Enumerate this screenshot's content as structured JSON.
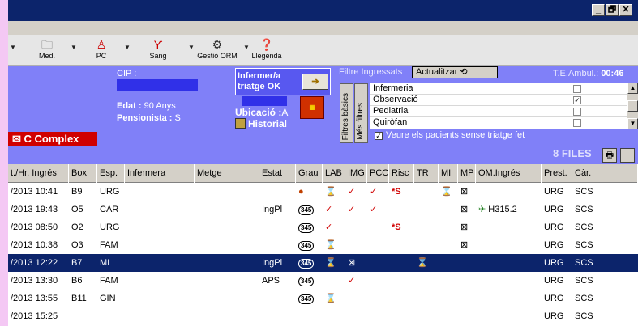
{
  "window": {
    "buttons": [
      "_",
      "🗗",
      "✕"
    ]
  },
  "toolbar": {
    "items": [
      {
        "label": "Med.",
        "icon": "folder-search-icon"
      },
      {
        "label": "PC",
        "icon": "pc-person-icon"
      },
      {
        "label": "Sang",
        "icon": "blood-icon"
      },
      {
        "label": "Gestió ORM",
        "icon": "orm-icon"
      },
      {
        "label": "Llegenda",
        "icon": "help-icon"
      }
    ]
  },
  "panel": {
    "cip_label": "CIP :",
    "edat_label": "Edat :",
    "edat_value": "90 Anys",
    "pensionista_label": "Pensionista :",
    "pensionista_value": "S",
    "triatge_line1": "Infermer/a",
    "triatge_line2": "triatge OK",
    "ubicacio_label": "Ubicació :",
    "ubicacio_value": "A",
    "historial": "Historial",
    "complex": "C Complex",
    "tab_basic": "Filtres bàsics",
    "tab_more": "Més filtres",
    "filtre_label": "Filtre Ingressats",
    "actualitzar": "Actualitzar",
    "temps_label": "T.E.Ambul.:",
    "temps_value": "00:46",
    "veure": "Veure els pacients sense triatge fet",
    "veure_checked": true,
    "filters": [
      {
        "name": "Infermeria",
        "checked": false
      },
      {
        "name": "Observació",
        "checked": true
      },
      {
        "name": "Pediatria",
        "checked": false
      },
      {
        "name": "Quiròfan",
        "checked": false
      }
    ]
  },
  "files_label": "8 FILES",
  "table": {
    "columns": [
      "t./Hr. Ingrés",
      "Box",
      "Esp.",
      "Infermera",
      "Metge",
      "Estat",
      "Grau",
      "LAB",
      "IMG",
      "PCO",
      "Risc",
      "TR",
      "MI",
      "MP",
      "OM.Ingrés",
      "Prest.",
      "Càr."
    ],
    "rows": [
      {
        "date": "/2013 10:41",
        "box": "B9",
        "esp": "URG",
        "infermera": "",
        "metge": "",
        "estat": "",
        "grau": "●",
        "lab": "⌛",
        "img": "✓",
        "pco": "✓",
        "risc": "*S",
        "tr": "",
        "mi": "⌛",
        "mp": "⊠",
        "om": "",
        "prest": "URG",
        "car": "SCS"
      },
      {
        "date": "/2013 19:43",
        "box": "O5",
        "esp": "CAR",
        "infermera": "",
        "metge": "",
        "estat": "IngPl",
        "grau": "345",
        "lab": "✓",
        "img": "✓",
        "pco": "✓",
        "risc": "",
        "tr": "",
        "mi": "",
        "mp": "⊠",
        "om": "H315.2",
        "prest": "URG",
        "car": "SCS"
      },
      {
        "date": "/2013 08:50",
        "box": "O2",
        "esp": "URG",
        "infermera": "",
        "metge": "",
        "estat": "",
        "grau": "345",
        "lab": "✓",
        "img": "",
        "pco": "",
        "risc": "*S",
        "tr": "",
        "mi": "",
        "mp": "⊠",
        "om": "",
        "prest": "URG",
        "car": "SCS"
      },
      {
        "date": "/2013 10:38",
        "box": "O3",
        "esp": "FAM",
        "infermera": "",
        "metge": "",
        "estat": "",
        "grau": "345",
        "lab": "⌛",
        "img": "",
        "pco": "",
        "risc": "",
        "tr": "",
        "mi": "",
        "mp": "⊠",
        "om": "",
        "prest": "URG",
        "car": "SCS"
      },
      {
        "date": "/2013 12:22",
        "box": "B7",
        "esp": "MI",
        "infermera": "",
        "metge": "",
        "estat": "IngPl",
        "grau": "345",
        "lab": "⌛",
        "img": "⊠",
        "pco": "",
        "risc": "",
        "tr": "⌛",
        "mi": "",
        "mp": "",
        "om": "",
        "prest": "URG",
        "car": "SCS"
      },
      {
        "date": "/2013 13:30",
        "box": "B6",
        "esp": "FAM",
        "infermera": "",
        "metge": "",
        "estat": "APS",
        "grau": "345",
        "lab": "",
        "img": "✓",
        "pco": "",
        "risc": "",
        "tr": "",
        "mi": "",
        "mp": "",
        "om": "",
        "prest": "URG",
        "car": "SCS"
      },
      {
        "date": "/2013 13:55",
        "box": "B11",
        "esp": "GIN",
        "infermera": "",
        "metge": "",
        "estat": "",
        "grau": "345",
        "lab": "⌛",
        "img": "",
        "pco": "",
        "risc": "",
        "tr": "",
        "mi": "",
        "mp": "",
        "om": "",
        "prest": "URG",
        "car": "SCS"
      },
      {
        "date": "/2013 15:25",
        "box": "",
        "esp": "",
        "infermera": "",
        "metge": "",
        "estat": "",
        "grau": "",
        "lab": "",
        "img": "",
        "pco": "",
        "risc": "",
        "tr": "",
        "mi": "",
        "mp": "",
        "om": "",
        "prest": "URG",
        "car": "SCS"
      }
    ]
  },
  "colors": {
    "title": "#0c246b",
    "panel": "#8080f8",
    "selected": "#0c246b",
    "complex": "#d00000"
  }
}
